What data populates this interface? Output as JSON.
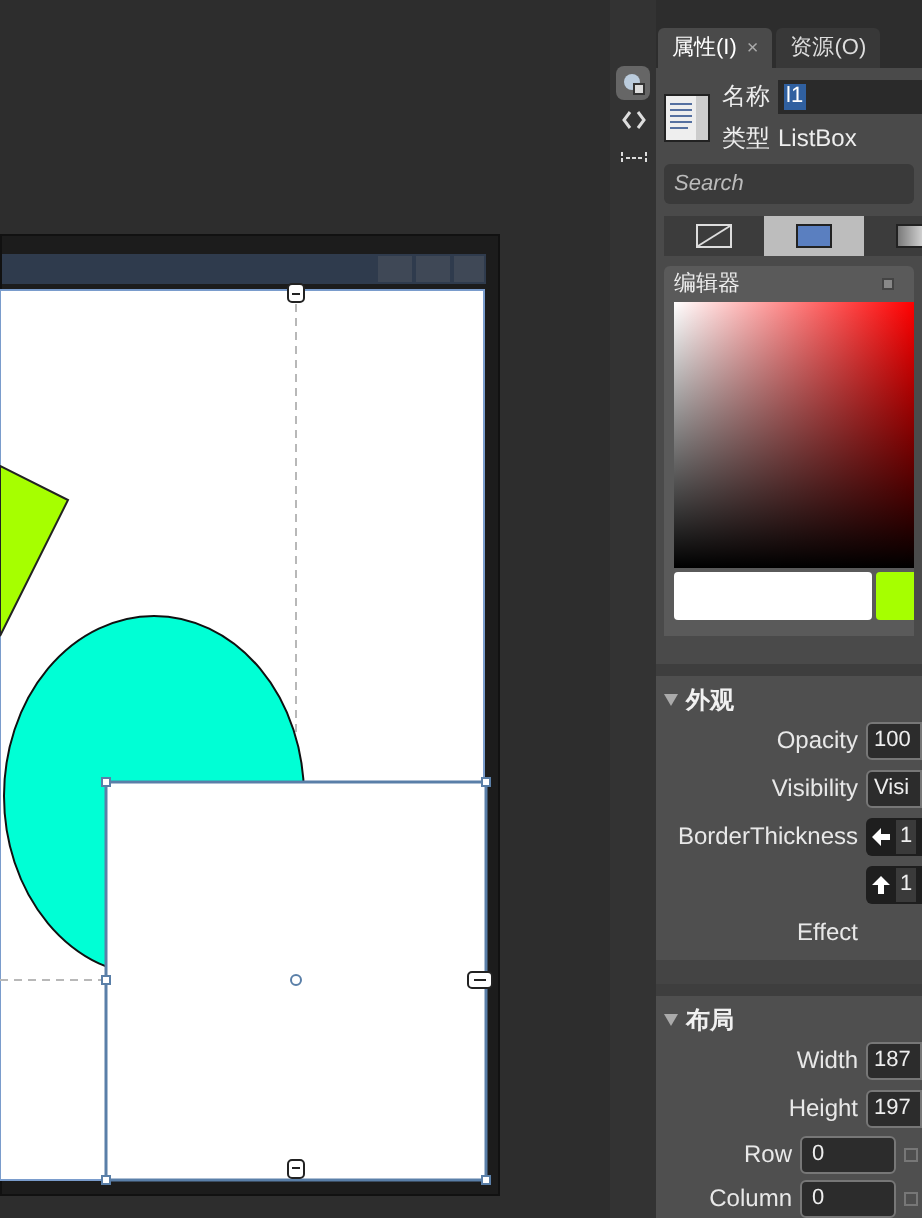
{
  "tabs": [
    {
      "label": "属性(I)",
      "selected": true,
      "close": "×"
    },
    {
      "label": "资源(O)",
      "selected": false
    }
  ],
  "element": {
    "name_label": "名称",
    "name_value": "l1",
    "type_label": "类型",
    "type_value": "ListBox"
  },
  "search": {
    "placeholder": "Search"
  },
  "brush_tabs": [
    {
      "kind": "none",
      "selected": false
    },
    {
      "kind": "solid",
      "selected": true
    },
    {
      "kind": "gradient",
      "selected": false
    }
  ],
  "editor": {
    "title": "编辑器"
  },
  "sections": [
    {
      "title": "外观",
      "expanded": true,
      "rows": [
        {
          "kind": "field",
          "label": "Opacity",
          "value": "100"
        },
        {
          "kind": "field",
          "label": "Visibility",
          "value": "Visi"
        },
        {
          "kind": "arrow-left",
          "label": "BorderThickness",
          "value": "1"
        },
        {
          "kind": "arrow-up",
          "value": "1"
        },
        {
          "kind": "text",
          "label": "Effect"
        }
      ]
    },
    {
      "title": "布局",
      "expanded": true,
      "rows": [
        {
          "kind": "field",
          "label": "Width",
          "value": "187"
        },
        {
          "kind": "field",
          "label": "Height",
          "value": "197"
        },
        {
          "kind": "wide",
          "label": "Row",
          "value": "0"
        },
        {
          "kind": "wide",
          "label": "Column",
          "value": "0"
        }
      ]
    }
  ]
}
